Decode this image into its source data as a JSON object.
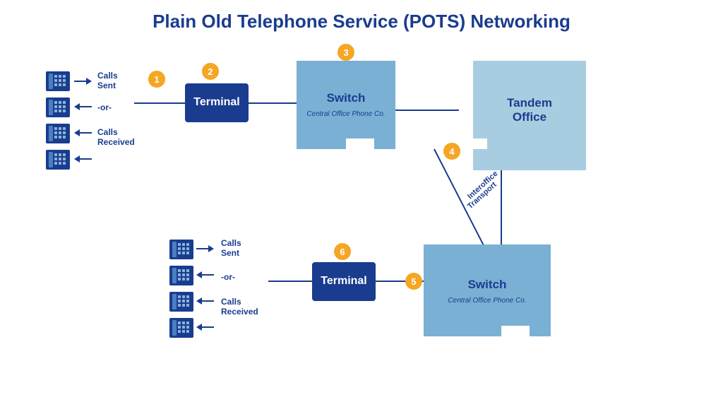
{
  "title": "Plain Old Telephone Service (POTS) Networking",
  "badges": {
    "b1": "1",
    "b2": "2",
    "b3": "3",
    "b4": "4",
    "b5": "5",
    "b6": "6"
  },
  "labels": {
    "calls_sent": "Calls\nSent",
    "calls_received": "Calls\nReceived",
    "or": "-or-",
    "terminal": "Terminal",
    "switch_title": "Switch",
    "switch_subtitle": "Central Office Phone Co.",
    "tandem_title": "Tandem\nOffice",
    "interoffice": "Interoffice\nTransport"
  },
  "colors": {
    "dark_blue": "#1a3c8f",
    "light_blue": "#7ab0d4",
    "lighter_blue": "#a8cde0",
    "orange": "#f5a623",
    "white": "#ffffff"
  }
}
